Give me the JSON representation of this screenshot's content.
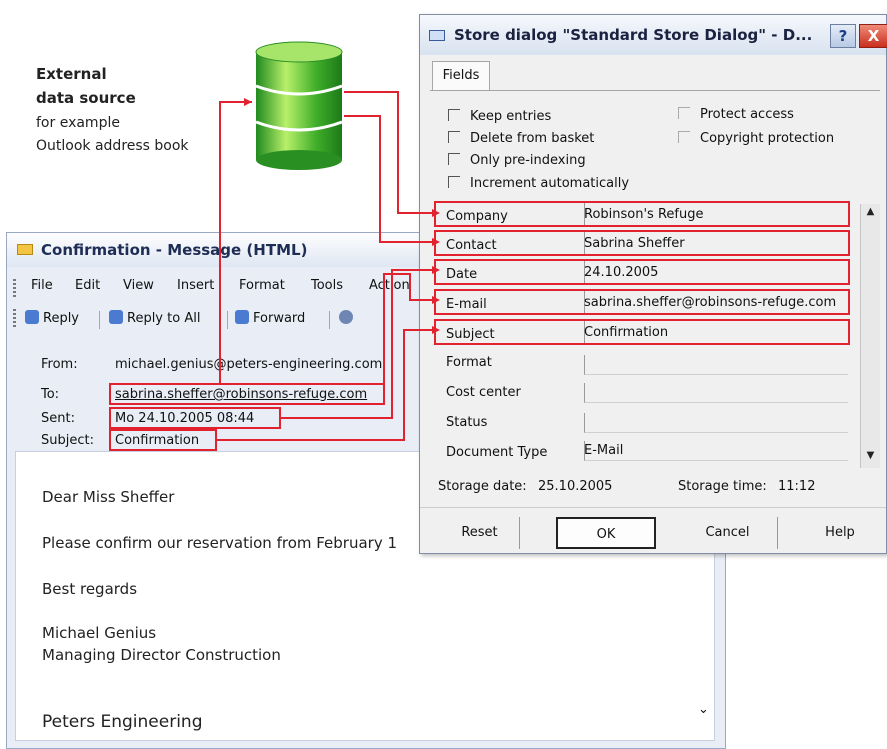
{
  "external": {
    "title_line1": "External",
    "title_line2": "data source",
    "sub_line1": "for example",
    "sub_line2": "Outlook address book"
  },
  "message": {
    "window_title": "Confirmation - Message (HTML)",
    "menu": [
      "File",
      "Edit",
      "View",
      "Insert",
      "Format",
      "Tools",
      "Action"
    ],
    "toolbar": [
      "Reply",
      "Reply to All",
      "Forward"
    ],
    "headers": {
      "from_label": "From:",
      "from_value": "michael.genius@peters-engineering.com",
      "to_label": "To:",
      "to_value": "sabrina.sheffer@robinsons-refuge.com",
      "sent_label": "Sent:",
      "sent_value": "Mo 24.10.2005 08:44",
      "subject_label": "Subject:",
      "subject_value": "Confirmation"
    },
    "body": {
      "greeting": "Dear Miss Sheffer",
      "line1": "Please confirm our reservation from February 1",
      "closing": "Best regards",
      "sig_name": "Michael Genius",
      "sig_title": "Managing Director Construction",
      "company": "Peters Engineering"
    }
  },
  "dialog": {
    "title": "Store dialog \"Standard Store Dialog\" - D...",
    "help_label": "?",
    "close_label": "X",
    "tab_label": "Fields",
    "checkboxes_left": [
      "Keep entries",
      "Delete from basket",
      "Only pre-indexing",
      "Increment automatically"
    ],
    "checkboxes_right": [
      "Protect access",
      "Copyright protection"
    ],
    "fields": {
      "company_label": "Company",
      "company_value": "Robinson's Refuge",
      "contact_label": "Contact",
      "contact_value": "Sabrina Sheffer",
      "date_label": "Date",
      "date_value": "24.10.2005",
      "email_label": "E-mail",
      "email_value": "sabrina.sheffer@robinsons-refuge.com",
      "subject_label": "Subject",
      "subject_value": "Confirmation",
      "format_label": "Format",
      "costcenter_label": "Cost center",
      "status_label": "Status",
      "doctype_label": "Document Type",
      "doctype_value": "E-Mail"
    },
    "storage_date_label": "Storage date:",
    "storage_date_value": "25.10.2005",
    "storage_time_label": "Storage time:",
    "storage_time_value": "11:12",
    "buttons": {
      "reset": "Reset",
      "ok": "OK",
      "cancel": "Cancel",
      "help": "Help"
    }
  },
  "colors": {
    "highlight": "#e3222f",
    "db_green": "#3fae2a"
  }
}
